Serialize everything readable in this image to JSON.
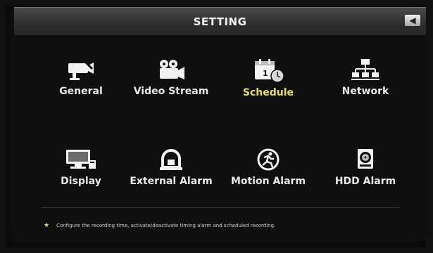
{
  "window": {
    "title": "SETTING",
    "back_icon": "back-arrow-icon"
  },
  "menu": {
    "active": "Schedule",
    "items": [
      {
        "label": "General",
        "icon": "camera-settings-icon"
      },
      {
        "label": "Video Stream",
        "icon": "video-camera-icon"
      },
      {
        "label": "Schedule",
        "icon": "calendar-clock-icon"
      },
      {
        "label": "Network",
        "icon": "network-icon"
      },
      {
        "label": "Display",
        "icon": "monitor-icon"
      },
      {
        "label": "External Alarm",
        "icon": "alarm-bell-icon"
      },
      {
        "label": "Motion Alarm",
        "icon": "running-person-icon"
      },
      {
        "label": "HDD Alarm",
        "icon": "hard-drive-icon"
      }
    ]
  },
  "hint": {
    "text": "Configure the recording time, activate/deactivate timing alarm and scheduled recording."
  },
  "colors": {
    "active_label": "#e9e04a",
    "label": "#e8e8e8",
    "background": "#121212"
  }
}
